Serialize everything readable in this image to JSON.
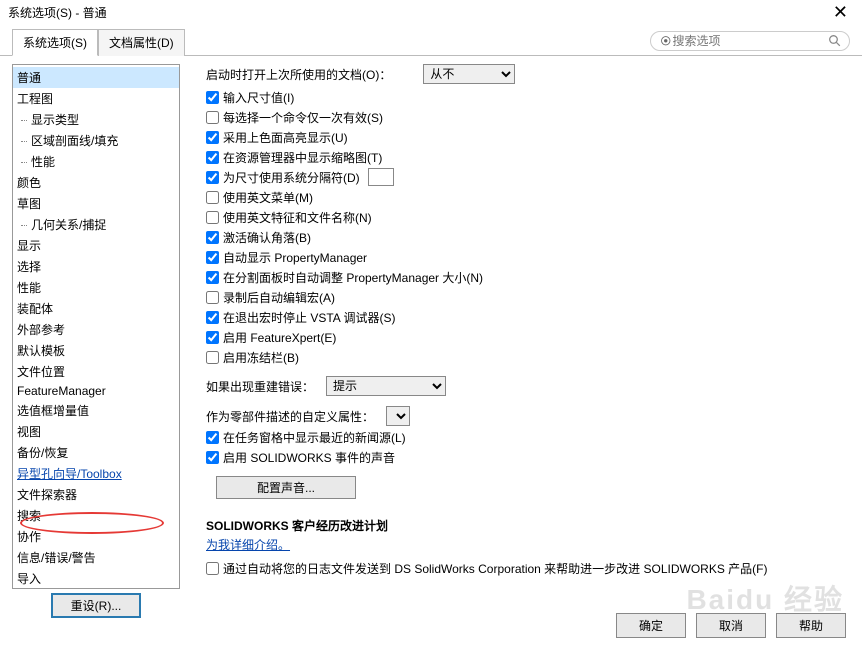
{
  "title": "系统选项(S) - 普通",
  "tabs": {
    "system": "系统选项(S)",
    "doc": "文档属性(D)"
  },
  "search": {
    "placeholder": "搜索选项"
  },
  "nav": {
    "items": [
      {
        "label": "普通",
        "sub": false,
        "selected": true
      },
      {
        "label": "工程图",
        "sub": false
      },
      {
        "label": "显示类型",
        "sub": true
      },
      {
        "label": "区域剖面线/填充",
        "sub": true
      },
      {
        "label": "性能",
        "sub": true
      },
      {
        "label": "颜色",
        "sub": false
      },
      {
        "label": "草图",
        "sub": false
      },
      {
        "label": "几何关系/捕捉",
        "sub": true
      },
      {
        "label": "显示",
        "sub": false
      },
      {
        "label": "选择",
        "sub": false
      },
      {
        "label": "性能",
        "sub": false
      },
      {
        "label": "装配体",
        "sub": false
      },
      {
        "label": "外部参考",
        "sub": false
      },
      {
        "label": "默认模板",
        "sub": false
      },
      {
        "label": "文件位置",
        "sub": false
      },
      {
        "label": "FeatureManager",
        "sub": false
      },
      {
        "label": "选值框增量值",
        "sub": false
      },
      {
        "label": "视图",
        "sub": false
      },
      {
        "label": "备份/恢复",
        "sub": false
      },
      {
        "label": "异型孔向导/Toolbox",
        "sub": false,
        "link": true
      },
      {
        "label": "文件探索器",
        "sub": false
      },
      {
        "label": "搜索",
        "sub": false
      },
      {
        "label": "协作",
        "sub": false
      },
      {
        "label": "信息/错误/警告",
        "sub": false
      },
      {
        "label": "导入",
        "sub": false
      }
    ],
    "reset": "重设(R)..."
  },
  "main": {
    "startup": {
      "label": "启动时打开上次所使用的文档(O)：",
      "value": "从不"
    },
    "checks": [
      {
        "label": "输入尺寸值(I)",
        "checked": true
      },
      {
        "label": "每选择一个命令仅一次有效(S)",
        "checked": false
      },
      {
        "label": "采用上色面高亮显示(U)",
        "checked": true
      },
      {
        "label": "在资源管理器中显示缩略图(T)",
        "checked": true
      },
      {
        "label": "为尺寸使用系统分隔符(D)",
        "checked": true,
        "sepBox": true
      },
      {
        "label": "使用英文菜单(M)",
        "checked": false
      },
      {
        "label": "使用英文特征和文件名称(N)",
        "checked": false
      },
      {
        "label": "激活确认角落(B)",
        "checked": true
      },
      {
        "label": "自动显示 PropertyManager",
        "checked": true
      },
      {
        "label": "在分割面板时自动调整 PropertyManager 大小(N)",
        "checked": true
      },
      {
        "label": "录制后自动编辑宏(A)",
        "checked": false
      },
      {
        "label": "在退出宏时停止 VSTA 调试器(S)",
        "checked": true
      },
      {
        "label": "启用 FeatureXpert(E)",
        "checked": true
      },
      {
        "label": "启用冻结栏(B)",
        "checked": false
      }
    ],
    "rebuild": {
      "label": "如果出现重建错误：",
      "value": "提示"
    },
    "customProp": {
      "label": "作为零部件描述的自定义属性："
    },
    "checks2": [
      {
        "label": "在任务窗格中显示最近的新闻源(L)",
        "checked": true
      },
      {
        "label": "启用 SOLIDWORKS 事件的声音",
        "checked": true
      }
    ],
    "soundBtn": "配置声音...",
    "plan": {
      "title": "SOLIDWORKS 客户经历改进计划",
      "link": "为我详细介绍。",
      "checkbox": "通过自动将您的日志文件发送到 DS SolidWorks Corporation 来帮助进一步改进 SOLIDWORKS 产品(F)"
    }
  },
  "footer": {
    "ok": "确定",
    "cancel": "取消",
    "help": "帮助"
  },
  "watermark": "Baidu 经验"
}
